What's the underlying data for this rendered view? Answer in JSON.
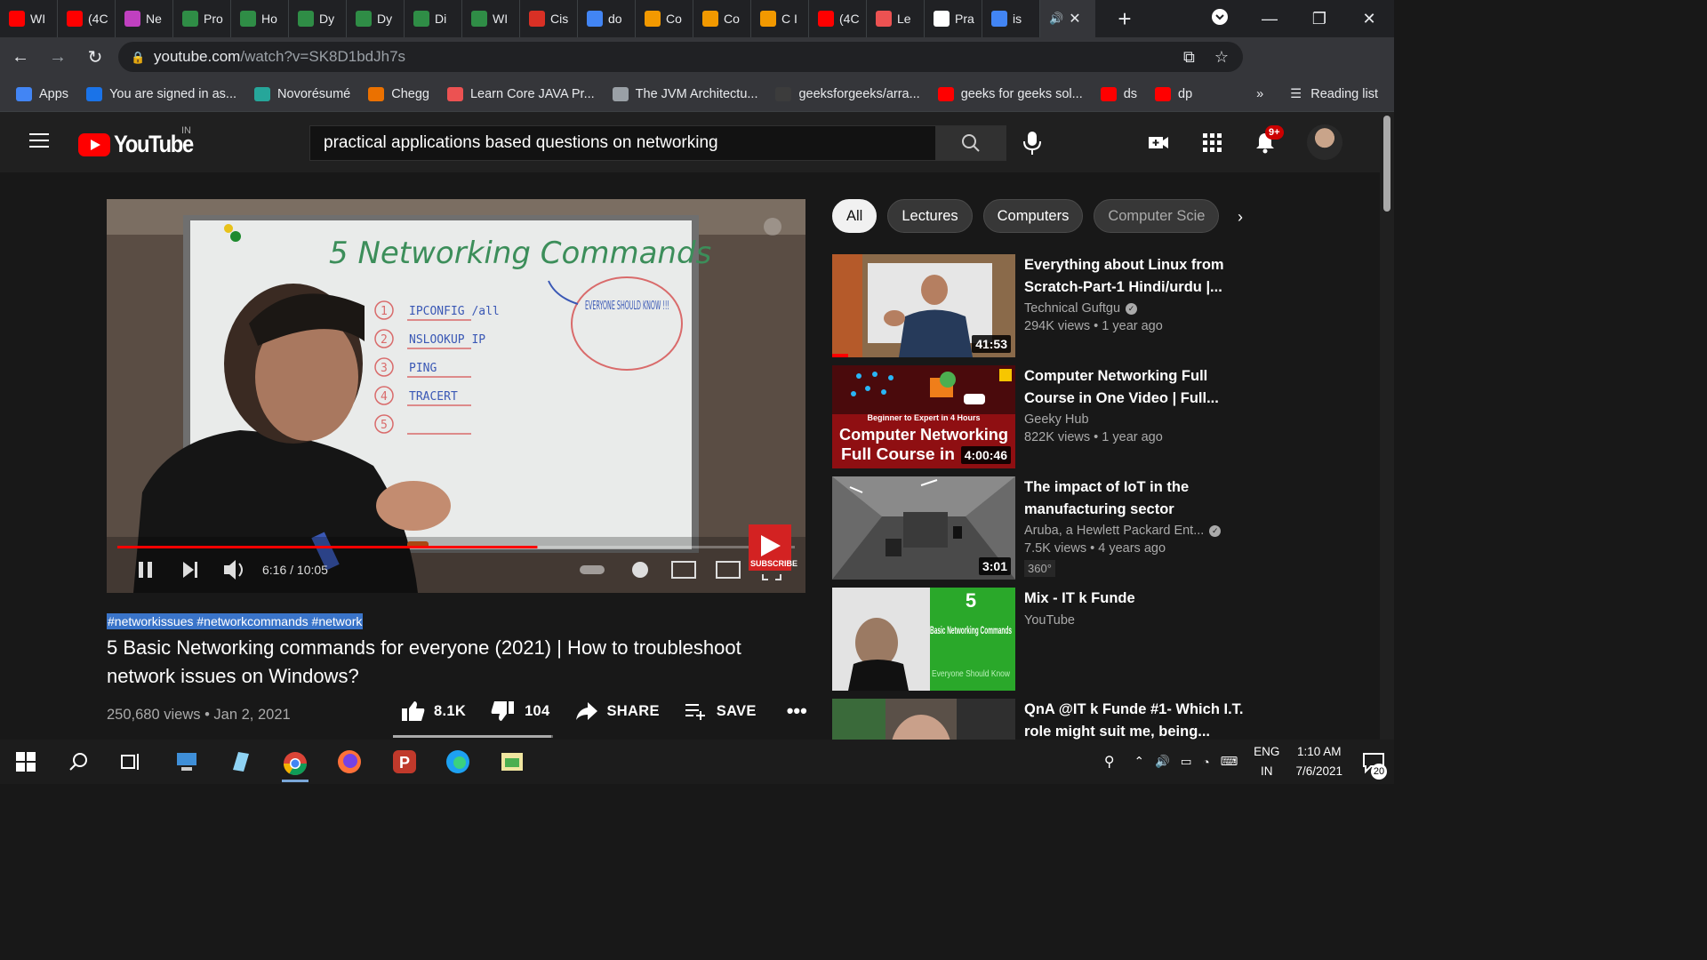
{
  "browser": {
    "tabs": [
      {
        "label": "WI",
        "icon": "youtube-icon",
        "color": "#ff0000"
      },
      {
        "label": "(4C",
        "icon": "youtube-icon",
        "color": "#ff0000"
      },
      {
        "label": "Ne",
        "icon": "m-icon",
        "color": "#c040c0"
      },
      {
        "label": "Pro",
        "icon": "gfg-icon",
        "color": "#2f8d46"
      },
      {
        "label": "Ho",
        "icon": "gfg-icon",
        "color": "#2f8d46"
      },
      {
        "label": "Dy",
        "icon": "gfg-icon",
        "color": "#2f8d46"
      },
      {
        "label": "Dy",
        "icon": "gfg-icon",
        "color": "#2f8d46"
      },
      {
        "label": "Di",
        "icon": "gfg-icon",
        "color": "#2f8d46"
      },
      {
        "label": "WI",
        "icon": "gfg-icon",
        "color": "#2f8d46"
      },
      {
        "label": "Cis",
        "icon": "dot-icon",
        "color": "#d93025"
      },
      {
        "label": "do",
        "icon": "google-icon",
        "color": "#4285f4"
      },
      {
        "label": "Co",
        "icon": "jt-icon",
        "color": "#f29900"
      },
      {
        "label": "Co",
        "icon": "jt-icon",
        "color": "#f29900"
      },
      {
        "label": "C I",
        "icon": "jt-icon",
        "color": "#f29900"
      },
      {
        "label": "(4C",
        "icon": "youtube-icon",
        "color": "#ff0000"
      },
      {
        "label": "Le",
        "icon": "udemy-icon",
        "color": "#ec5252"
      },
      {
        "label": "Pra",
        "icon": "globe-icon",
        "color": "#ffffff"
      },
      {
        "label": "is",
        "icon": "google-icon",
        "color": "#4285f4"
      }
    ],
    "active_tab_icons": "speaker-icon",
    "url_host": "youtube.com",
    "url_path": "/watch?v=SK8D1bdJh7s",
    "bookmarks": [
      {
        "label": "Apps",
        "icon": "apps-grid-icon",
        "color": "#4285f4"
      },
      {
        "label": "You are signed in as...",
        "icon": "s-icon",
        "color": "#1a73e8"
      },
      {
        "label": "Novorésumé",
        "icon": "n-icon",
        "color": "#26a69a"
      },
      {
        "label": "Chegg",
        "icon": "c-icon",
        "color": "#eb7100"
      },
      {
        "label": "Learn Core JAVA Pr...",
        "icon": "udemy-icon",
        "color": "#ec5252"
      },
      {
        "label": "The JVM Architectu...",
        "icon": "globe-icon",
        "color": "#9aa0a6"
      },
      {
        "label": "geeksforgeeks/arra...",
        "icon": "github-icon",
        "color": "#3c3c3c"
      },
      {
        "label": "geeks for geeks sol...",
        "icon": "youtube-icon",
        "color": "#ff0000"
      },
      {
        "label": "ds",
        "icon": "youtube-icon",
        "color": "#ff0000"
      },
      {
        "label": "dp",
        "icon": "youtube-icon",
        "color": "#ff0000"
      }
    ],
    "overflow": "»",
    "reading_list": "Reading list"
  },
  "youtube": {
    "logo_text": "YouTube",
    "region": "IN",
    "search_value": "practical applications based questions on networking",
    "notifications_badge": "9+",
    "video": {
      "time": "6:16 / 10:05",
      "progress": 0.62,
      "subscribe_label": "SUBSCRIBE",
      "board_title": "5 Networking Commands",
      "board_note": "EVERYONE SHOULD KNOW !!!",
      "board_items": [
        "IPCONFIG /all",
        "NSLOOKUP IP",
        "PING",
        "TRACERT",
        ""
      ],
      "hashtags": "#networkissues #networkcommands #network",
      "title": "5 Basic Networking commands for everyone (2021) | How to troubleshoot network issues on Windows?",
      "views_date": "250,680 views • Jan 2, 2021",
      "likes": "8.1K",
      "dislikes": "104",
      "share_label": "SHARE",
      "save_label": "SAVE",
      "like_ratio": 0.987
    },
    "chips": [
      "All",
      "Lectures",
      "Computers",
      "Computer Scie"
    ],
    "related": [
      {
        "title": "Everything about Linux from Scratch-Part-1 Hindi/urdu |...",
        "channel": "Technical Guftgu",
        "verified": true,
        "meta": "294K views • 1 year ago",
        "duration": "41:53"
      },
      {
        "title": "Computer Networking Full Course in One Video | Full...",
        "channel": "Geeky Hub",
        "verified": false,
        "meta": "822K views • 1 year ago",
        "duration": "4:00:46",
        "thumb_text_1": "Beginner to Expert in 4 Hours",
        "thumb_text_2": "Computer Networking",
        "thumb_text_3": "Full Course in"
      },
      {
        "title": "The impact of IoT in the manufacturing sector",
        "channel": "Aruba, a Hewlett Packard Ent...",
        "verified": true,
        "meta": "7.5K views • 4 years ago",
        "duration": "3:01",
        "tag": "360°"
      },
      {
        "title": "Mix - IT k Funde",
        "channel": "YouTube",
        "verified": false,
        "meta": "",
        "thumb_num": "5",
        "thumb_text": "Basic Networking Commands",
        "thumb_sub": "Everyone Should Know"
      },
      {
        "title": "QnA @IT k Funde #1- Which I.T. role might suit me, being...",
        "channel": "",
        "verified": false,
        "meta": ""
      }
    ]
  },
  "taskbar": {
    "lang_1": "ENG",
    "lang_2": "IN",
    "time": "1:10 AM",
    "date": "7/6/2021",
    "notifications": "20"
  }
}
